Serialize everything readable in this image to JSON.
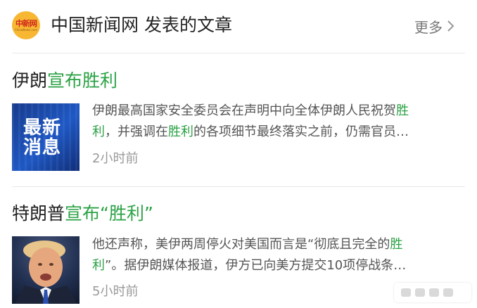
{
  "header": {
    "logo_text": "中新网",
    "logo_subtext": "ChinaNews.com",
    "title": "中国新闻网 发表的文章",
    "more_label": "更多"
  },
  "articles": [
    {
      "title_plain": "伊朗",
      "title_highlight": "宣布胜利",
      "thumbnail_text": [
        "最新",
        "消息"
      ],
      "snippet_lines": [
        [
          "伊朗最高国家安全委员会在声明中向全体伊朗人民祝贺",
          "胜"
        ],
        [
          "利",
          "，并强调在",
          "胜利",
          "的各项细节最终落实之前，仍需官员…"
        ]
      ],
      "time": "2小时前"
    },
    {
      "title_plain": "特朗普",
      "title_highlight": "宣布“胜利”",
      "snippet_lines": [
        [
          "他还声称，美伊两周停火对美国而言是“彻底且完全的",
          "胜"
        ],
        [
          "利",
          "”。据伊朗媒体报道，伊方已向美方提交10项停战条…"
        ]
      ],
      "time": "5小时前"
    }
  ],
  "colors": {
    "highlight": "#2ba245",
    "title": "#222222",
    "snippet": "#555555",
    "time": "#999999"
  },
  "icons": [
    "more-chevron-icon",
    "weibo-watermark-icon"
  ]
}
